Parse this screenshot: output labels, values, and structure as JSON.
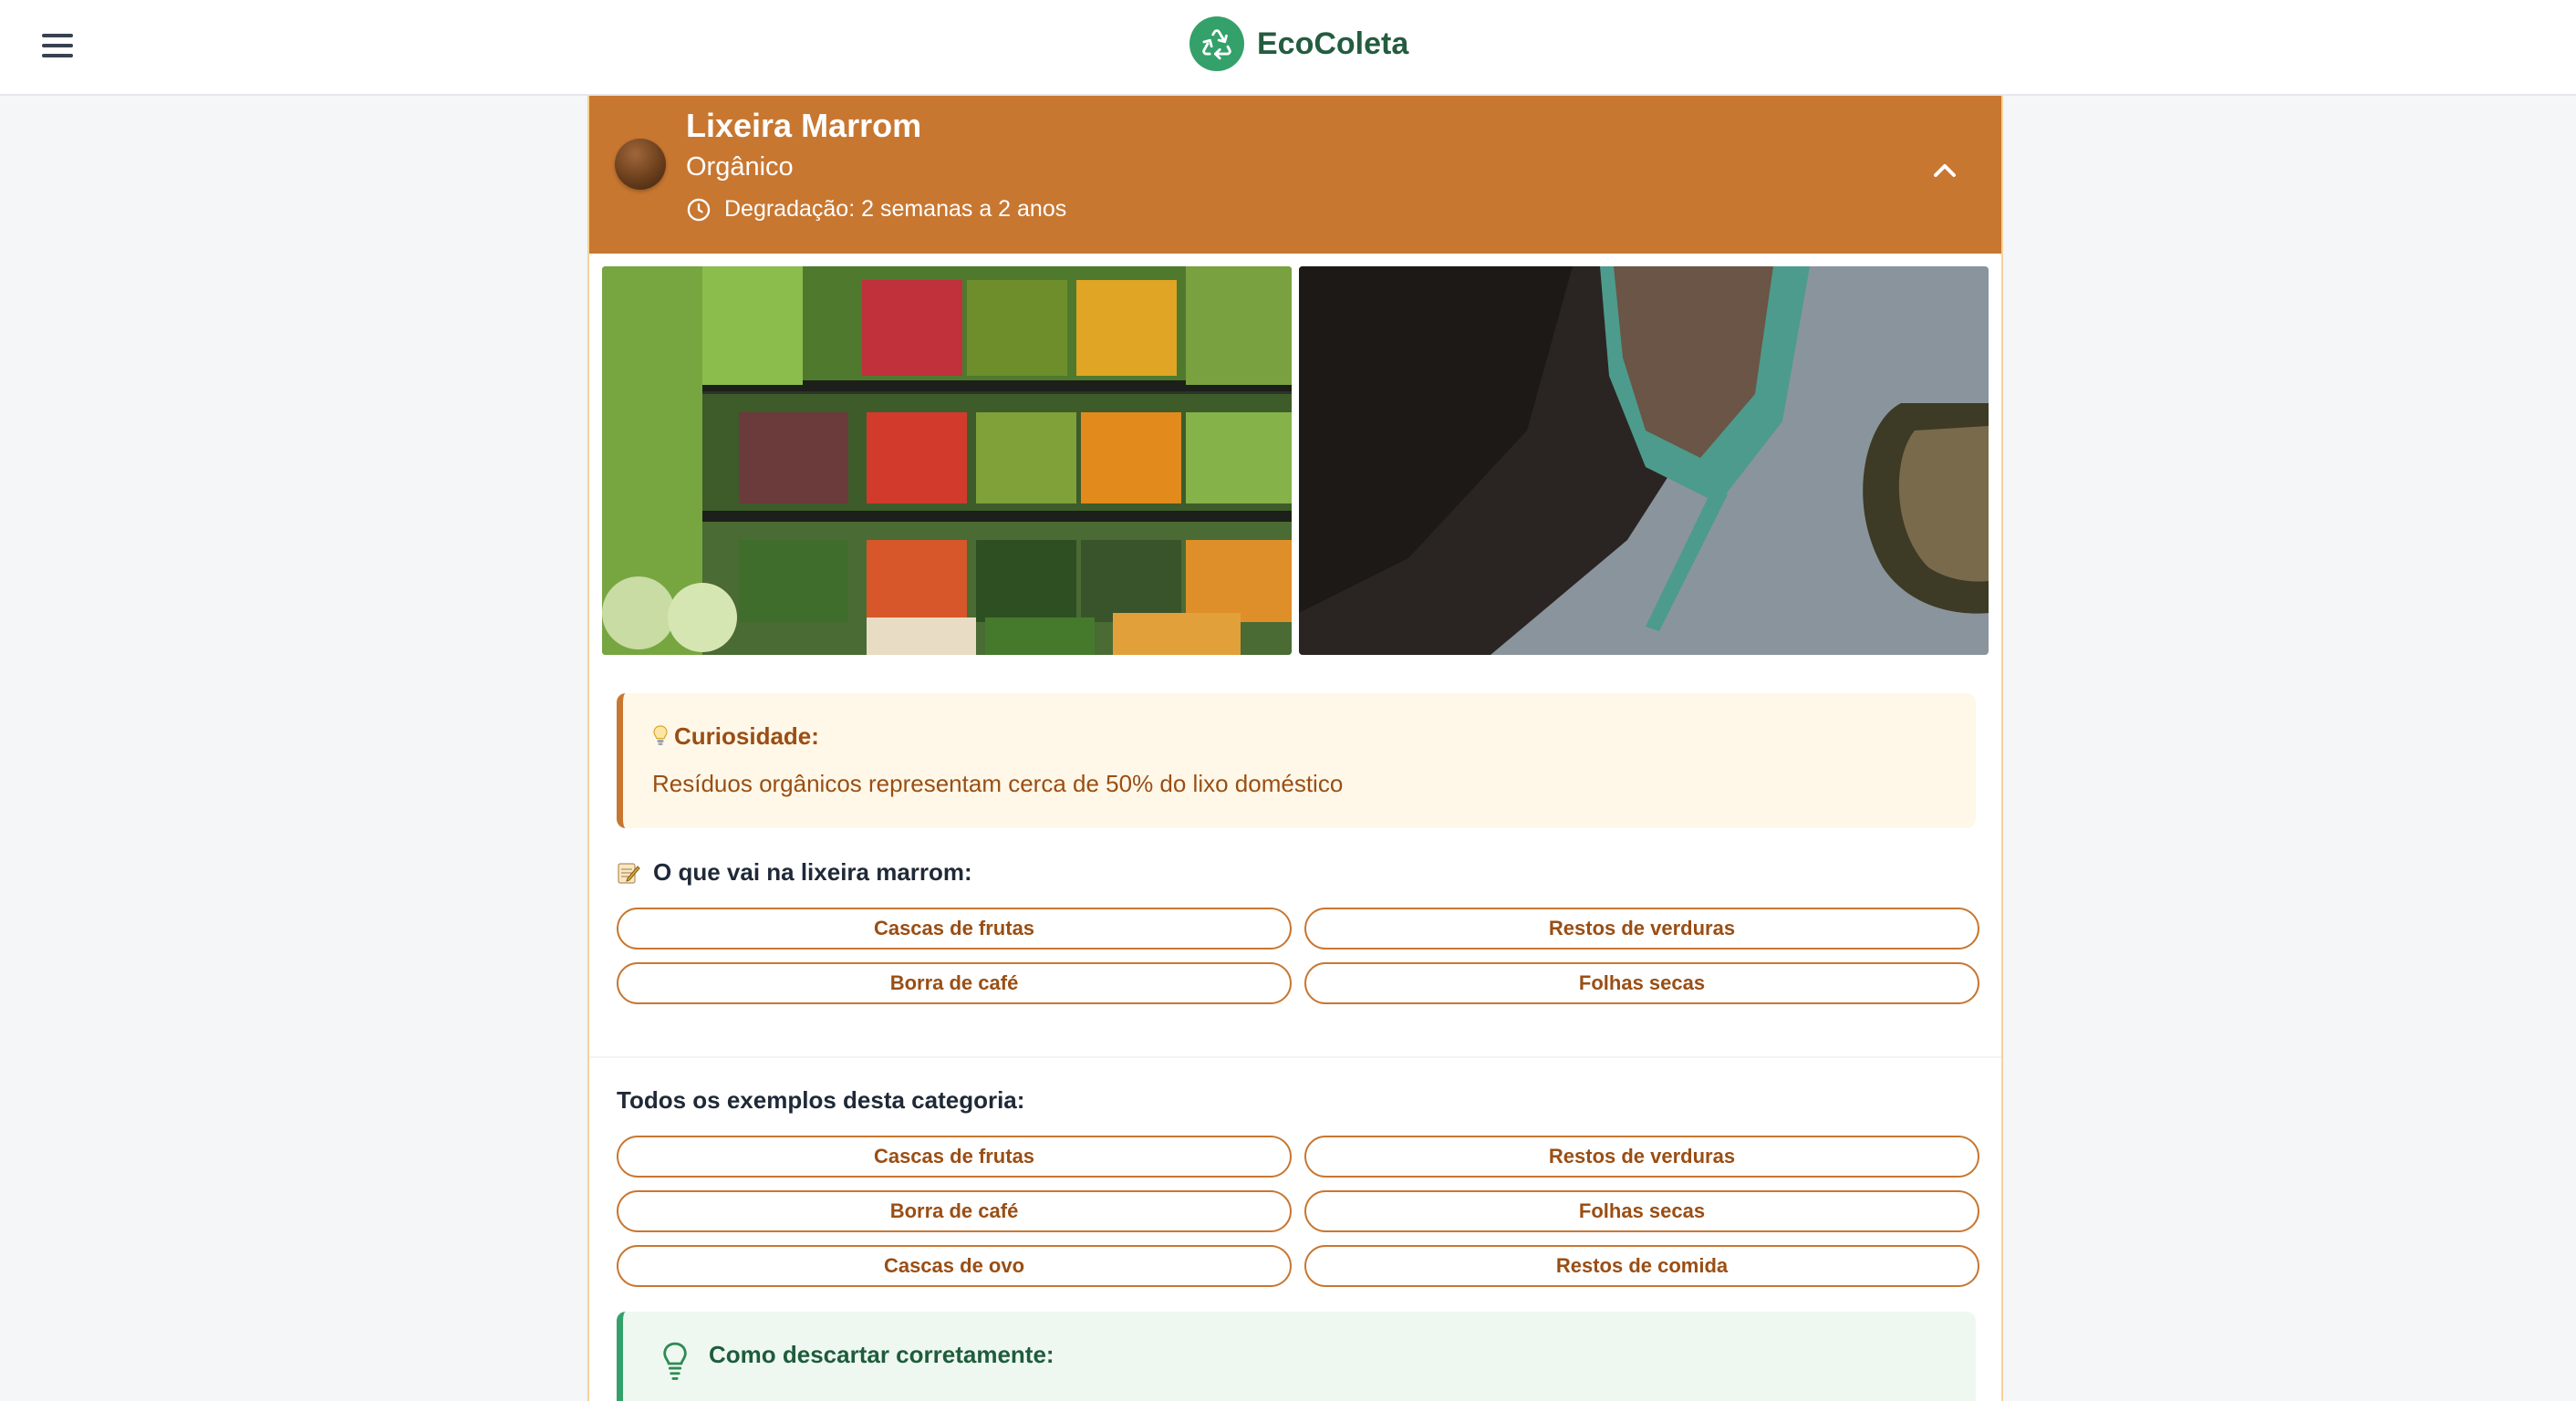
{
  "app": {
    "name": "EcoColeta"
  },
  "colors": {
    "accent": "#c87731",
    "brand": "#34a06a",
    "text_accent": "#9a4e14"
  },
  "header": {
    "title": "Lixeira Marrom",
    "subtitle": "Orgânico",
    "degradation": "Degradação: 2 semanas a 2 anos"
  },
  "curiosity": {
    "title": "Curiosidade:",
    "text": "Resíduos orgânicos representam cerca de 50% do lixo doméstico"
  },
  "what_goes": {
    "title": "O que vai na lixeira marrom:",
    "items": [
      "Cascas de frutas",
      "Restos de verduras",
      "Borra de café",
      "Folhas secas"
    ]
  },
  "all_examples": {
    "title": "Todos os exemplos desta categoria:",
    "items": [
      "Cascas de frutas",
      "Restos de verduras",
      "Borra de café",
      "Folhas secas",
      "Cascas de ovo",
      "Restos de comida"
    ]
  },
  "howto": {
    "title": "Como descartar corretamente:"
  }
}
